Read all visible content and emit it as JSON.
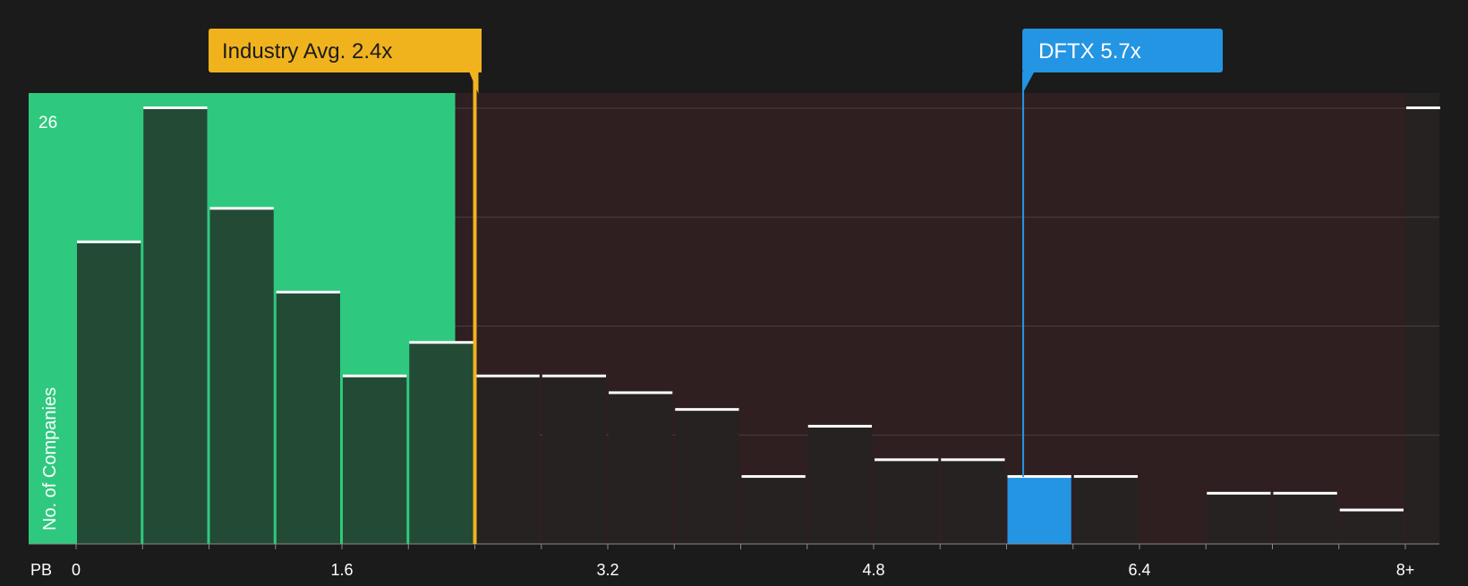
{
  "chart_data": {
    "type": "bar",
    "title": "",
    "xlabel": "PB",
    "ylabel": "No. of Companies",
    "y_max_label": "26",
    "ylim": [
      0,
      27
    ],
    "bin_width": 0.4,
    "x_ticks": [
      {
        "value": 0,
        "label": "0"
      },
      {
        "value": 1.6,
        "label": "1.6"
      },
      {
        "value": 3.2,
        "label": "3.2"
      },
      {
        "value": 4.8,
        "label": "4.8"
      },
      {
        "value": 6.4,
        "label": "6.4"
      },
      {
        "value": 8.0,
        "label": "8+"
      }
    ],
    "bins": [
      {
        "start": 0.0,
        "value": 18
      },
      {
        "start": 0.4,
        "value": 26
      },
      {
        "start": 0.8,
        "value": 20
      },
      {
        "start": 1.2,
        "value": 15
      },
      {
        "start": 1.6,
        "value": 10
      },
      {
        "start": 2.0,
        "value": 12
      },
      {
        "start": 2.4,
        "value": 10
      },
      {
        "start": 2.8,
        "value": 10
      },
      {
        "start": 3.2,
        "value": 9
      },
      {
        "start": 3.6,
        "value": 8
      },
      {
        "start": 4.0,
        "value": 4
      },
      {
        "start": 4.4,
        "value": 7
      },
      {
        "start": 4.8,
        "value": 5
      },
      {
        "start": 5.2,
        "value": 5
      },
      {
        "start": 5.6,
        "value": 4
      },
      {
        "start": 6.0,
        "value": 4
      },
      {
        "start": 6.4,
        "value": 0
      },
      {
        "start": 6.8,
        "value": 3
      },
      {
        "start": 7.2,
        "value": 3
      },
      {
        "start": 7.6,
        "value": 2
      },
      {
        "start": 8.0,
        "value": 26
      }
    ],
    "industry_avg": {
      "value": 2.4,
      "label": "Industry Avg. 2.4x"
    },
    "company": {
      "value": 5.7,
      "label": "DFTX 5.7x",
      "highlight_bin_start": 5.6
    },
    "colors": {
      "background": "#1b1b1b",
      "undervalued_zone": "#2ec97e",
      "overvalued_zone": "#2f1f20",
      "bar_green": "#234a35",
      "bar_dark": "#262222",
      "bar_top": "#ffffff",
      "industry": "#f0b31e",
      "company": "#2395e3",
      "gridline": "#4a4040",
      "axis_text": "#ffffff"
    }
  }
}
